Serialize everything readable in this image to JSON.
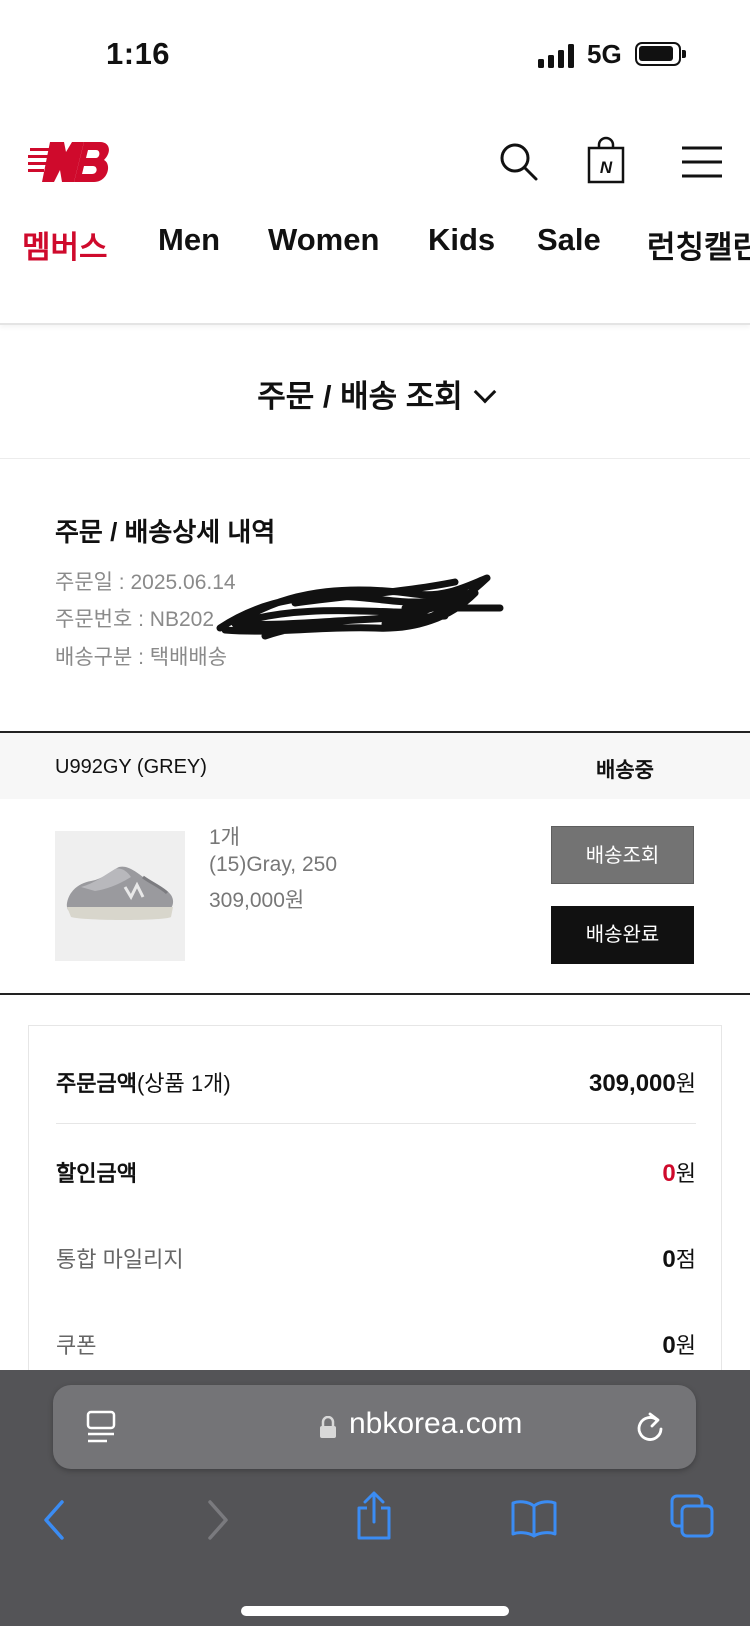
{
  "status_bar": {
    "time": "1:16",
    "network": "5G"
  },
  "brand": {
    "accent_color": "#cf0a2c",
    "logo_icon": "new-balance-logo"
  },
  "header_icons": [
    "search-icon",
    "shopping-bag-icon",
    "hamburger-menu-icon"
  ],
  "header": {
    "bag_letter": "N"
  },
  "nav": {
    "items": [
      {
        "label": "멤버스",
        "active": true
      },
      {
        "label": "Men",
        "active": false
      },
      {
        "label": "Women",
        "active": false
      },
      {
        "label": "Kids",
        "active": false
      },
      {
        "label": "Sale",
        "active": false
      },
      {
        "label": "런칭캘린",
        "active": false
      }
    ]
  },
  "page": {
    "title": "주문 / 배송 조회"
  },
  "order_detail": {
    "title": "주문 / 배송상세 내역",
    "order_date": "주문일 : 2025.06.14",
    "order_number": "주문번호 : NB202",
    "delivery_type": "배송구분 : 택배배송"
  },
  "product": {
    "name": "U992GY (GREY)",
    "status": "배송중",
    "quantity": "1개",
    "option": "(15)Gray, 250",
    "price": "309,000원",
    "track_button": "배송조회",
    "complete_button": "배송완료"
  },
  "summary": {
    "order_amount_label": "주문금액",
    "order_amount_sub": "(상품 1개)",
    "order_amount_value": "309,000",
    "order_amount_unit": "원",
    "discount_label": "할인금액",
    "discount_value": "0",
    "discount_unit": "원",
    "mileage_label": "통합 마일리지",
    "mileage_value": "0",
    "mileage_unit": "점",
    "coupon_label": "쿠폰",
    "coupon_value": "0",
    "coupon_unit": "원"
  },
  "browser": {
    "url": "nbkorea.com",
    "toolbar_icons": [
      "back-icon",
      "forward-icon",
      "share-icon",
      "bookmarks-icon",
      "tabs-icon"
    ]
  }
}
